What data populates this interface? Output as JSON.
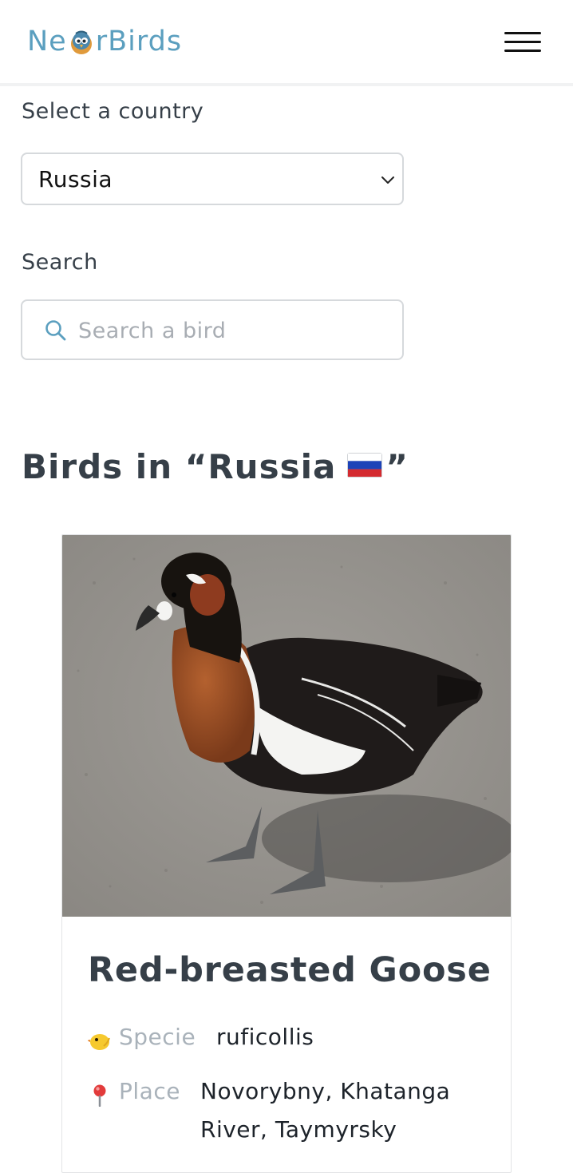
{
  "header": {
    "logo_text_before": "Ne",
    "logo_text_after": "rBirds",
    "brand_color": "#5b9fbf"
  },
  "filters": {
    "country_label": "Select a country",
    "country_selected": "Russia",
    "search_label": "Search",
    "search_placeholder": "Search a bird",
    "search_value": ""
  },
  "results": {
    "heading_prefix": "Birds in “Russia",
    "heading_suffix": "”",
    "flag": "russia-flag-icon"
  },
  "card": {
    "title": "Red-breasted Goose",
    "specie_label": "Specie",
    "specie_value": "ruficollis",
    "place_label": "Place",
    "place_value": "Novorybny, Khatanga River, Taymyrsky",
    "specie_icon": "chick-icon",
    "place_icon": "pin-icon"
  }
}
